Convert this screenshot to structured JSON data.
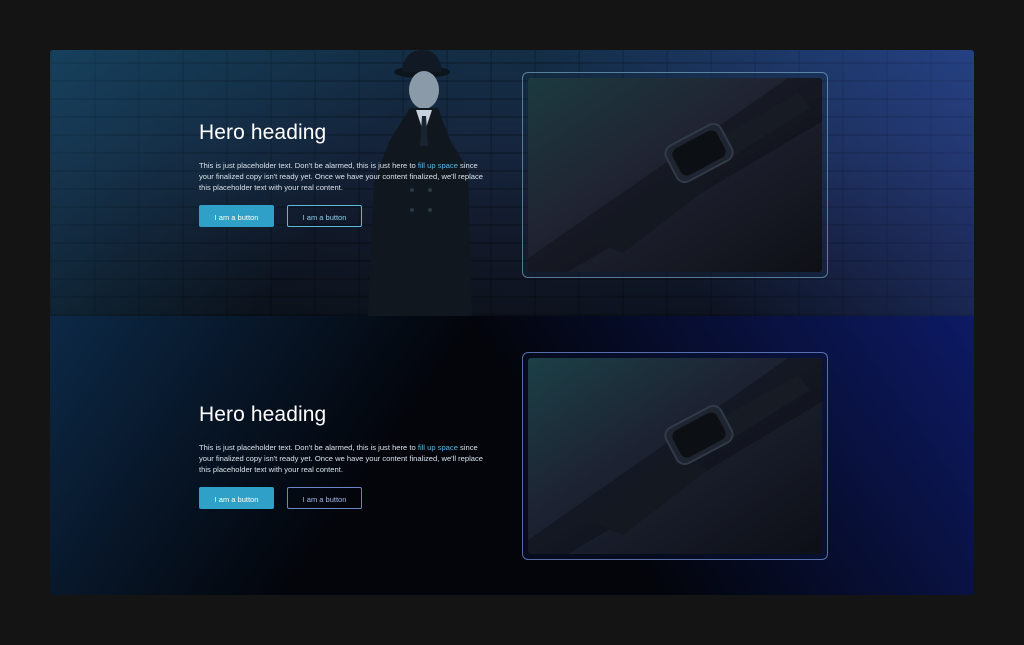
{
  "heroes": [
    {
      "heading": "Hero heading",
      "text_before": "This is just placeholder text. Don't be alarmed, this is just here to ",
      "link": "fill up space",
      "text_after": " since your finalized copy isn't ready yet. Once we have your content finalized, we'll replace this placeholder text with your real content.",
      "primary_button": "I am a button",
      "secondary_button": "I am a button"
    },
    {
      "heading": "Hero heading",
      "text_before": "This is just placeholder text. Don't be alarmed, this is just here to ",
      "link": "fill up space",
      "text_after": " since your finalized copy isn't ready yet. Once we have your content finalized, we'll replace this placeholder text with your real content.",
      "primary_button": "I am a button",
      "secondary_button": "I am a button"
    }
  ],
  "colors": {
    "page_background": "#141414",
    "primary_button": "#2fa0c8",
    "link": "#58b8e4"
  },
  "icons": [
    "smartwatch-image",
    "person-image"
  ]
}
